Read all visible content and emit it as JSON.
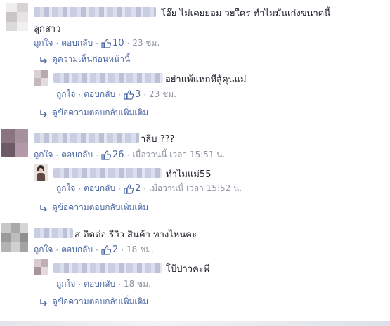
{
  "labels": {
    "like": "ถูกใจ",
    "reply": "ตอบกลับ",
    "dot": "·",
    "previous_comments": "ดูความเห็นก่อนหน้านี้",
    "more_replies": "ดูข้อความตอบกลับเพิ่มเติม"
  },
  "icons": {
    "like": "thumbs-up-icon",
    "reply_arrow": "reply-arrow-icon"
  },
  "colors": {
    "link": "#4b67a1",
    "meta": "#8d949e",
    "text": "#1d2129"
  },
  "comments": [
    {
      "text": "โอ๊ย ไม่เคยยอม  วยใคร ทำไมมันเก่งขนาดนี้",
      "text_line2": "ลูกสาว",
      "likes": "10",
      "time": "23 ชม.",
      "replies": [
        {
          "text": "อย่าแพ้แหกหีสู้คุนแม่",
          "likes": "3",
          "time": "23 ชม."
        }
      ]
    },
    {
      "text": "าลีบ ???",
      "likes": "26",
      "time": "เมื่อวานนี้ เวลา 15:51 น.",
      "replies": [
        {
          "text": "ทำไมแม่55",
          "likes": "2",
          "time": "เมื่อวานนี้ เวลา 15:52 น."
        }
      ]
    },
    {
      "text": "ส ติดต่อ รีวิว สินค้า ทางไหนคะ",
      "likes": "2",
      "time": "18 ชม.",
      "replies": [
        {
          "text": "โป้ปาวคะพี",
          "time": "18 ชม."
        }
      ]
    }
  ]
}
